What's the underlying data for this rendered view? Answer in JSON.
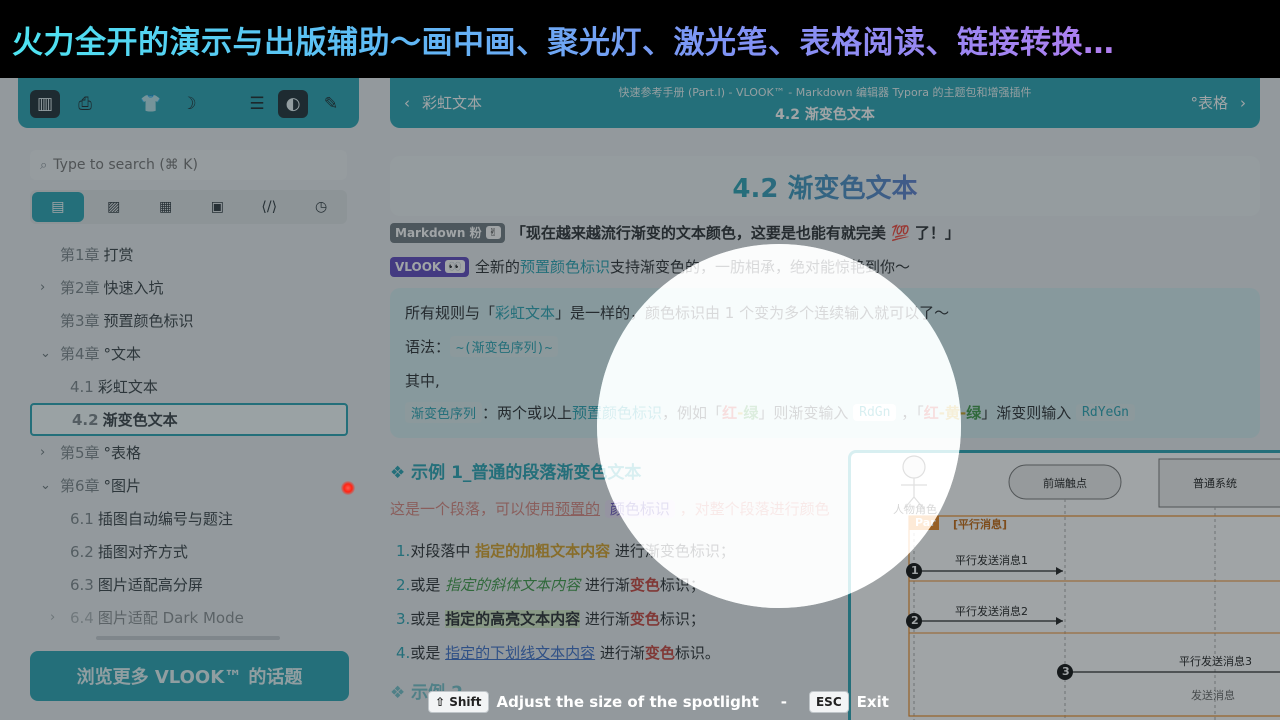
{
  "banner": {
    "text": "火力全开的演示与出版辅助～画中画、聚光灯、激光笔、表格阅读、链接转换…"
  },
  "sidebar": {
    "toolbar_icons": [
      "map-icon",
      "print-icon",
      "shirt-icon",
      "moon-icon",
      "list-indent-icon",
      "contrast-icon",
      "laser-pointer-icon"
    ],
    "search": {
      "placeholder": "Type to search (⌘ K)"
    },
    "tabs": [
      "list-icon",
      "image-icon",
      "table-icon",
      "video-icon",
      "code-icon",
      "history-icon"
    ],
    "outline": [
      {
        "num": "第1章",
        "label": "打赏"
      },
      {
        "num": "第2章",
        "label": "快速入坑"
      },
      {
        "num": "第3章",
        "label": "预置颜色标识"
      },
      {
        "num": "第4章",
        "label": "°文本"
      },
      {
        "num": "4.1",
        "label": "彩虹文本"
      },
      {
        "num": "4.2",
        "label": "渐变色文本"
      },
      {
        "num": "第5章",
        "label": "°表格"
      },
      {
        "num": "第6章",
        "label": "°图片"
      },
      {
        "num": "6.1",
        "label": "插图自动编号与题注"
      },
      {
        "num": "6.2",
        "label": "插图对齐方式"
      },
      {
        "num": "6.3",
        "label": "图片适配高分屏"
      },
      {
        "num": "6.4",
        "label": "图片适配 Dark Mode"
      }
    ],
    "browse_button": "浏览更多 VLOOK™ 的话题"
  },
  "docbar": {
    "prev": "彩虹文本",
    "subtitle": "快速参考手册 (Part.I) - VLOOK™ - Markdown 编辑器 Typora 的主题包和增强插件",
    "current": "4.2 渐变色文本",
    "next": "°表格"
  },
  "doc": {
    "heading_num": "4.2",
    "heading_text": "渐变色文本",
    "md_badge": "Markdown 粉",
    "md_badge_emoji": "✌",
    "quote": "「现在越来越流行渐变的文本颜色，这要是也能有就完美 💯 了！」",
    "vlook_badge": "VLOOK",
    "vlook_badge_emoji": "👀",
    "vlook_line_a": "全新的",
    "vlook_line_link": "预置颜色标识",
    "vlook_line_b": "支持渐变色的，一肪相承，绝对能惊艳到你～",
    "callout": {
      "line1_a": "所有规则与「",
      "line1_link": "彩虹文本",
      "line1_b": "」是一样的，颜色标识由 1 个变为多个连续输入就可以了～",
      "syntax_label": "语法：",
      "syntax_code": "~(渐变色序列)~",
      "where": "其中,",
      "seq_chip": "渐变色序列",
      "seq_a": "：两个或以上",
      "seq_link": "预置颜色标识",
      "seq_b": "，例如「",
      "red": "红",
      "dash": "-",
      "green": "绿",
      "seq_c": "」则渐变输入",
      "code1": "RdGn",
      "seq_d": "，「",
      "yellow": "黄",
      "seq_e": "」渐变则输入",
      "code2": "RdYeGn"
    },
    "example1_title": "❖ 示例 1_普通的段落渐变色文本",
    "para_a": "这是一个段落，可以使用",
    "para_b": "预置的",
    "para_pill": "颜色标识",
    "para_c": "，对整个段落进行",
    "para_d": "颜色",
    "list": [
      {
        "n": "1.",
        "a": "对段落中 ",
        "em": "指定的加粗文本内容",
        "b": " 进行渐变色标识；"
      },
      {
        "n": "2.",
        "a": "或是 ",
        "em": "指定的斜体文本内容",
        "b": " 进行渐",
        "c": "变色",
        "d": "标识；"
      },
      {
        "n": "3.",
        "a": "或是 ",
        "em": "指定的高亮文本内容",
        "b": " 进行渐",
        "c": "变色",
        "d": "标识；"
      },
      {
        "n": "4.",
        "a": "或是 ",
        "em": "指定的下划线文本内容",
        "b": " 进行渐",
        "c": "变色",
        "d": "标识。"
      }
    ],
    "example2_title": "❖ 示例 2_..."
  },
  "diagram": {
    "actor": "人物角色",
    "lane1": "前端触点",
    "lane2": "普通系统",
    "par_tag": "Par",
    "par_label": "[平行消息]",
    "msg1": "平行发送消息1",
    "msg2": "平行发送消息2",
    "msg3": "平行发送消息3",
    "msg4": "发送消息",
    "step1": "1",
    "step2": "2",
    "step3": "3"
  },
  "hint": {
    "shift_key": "⇧ Shift",
    "shift_text": "Adjust the size of the spotlight",
    "sep": "-",
    "esc_key": "ESC",
    "esc_text": "Exit"
  }
}
